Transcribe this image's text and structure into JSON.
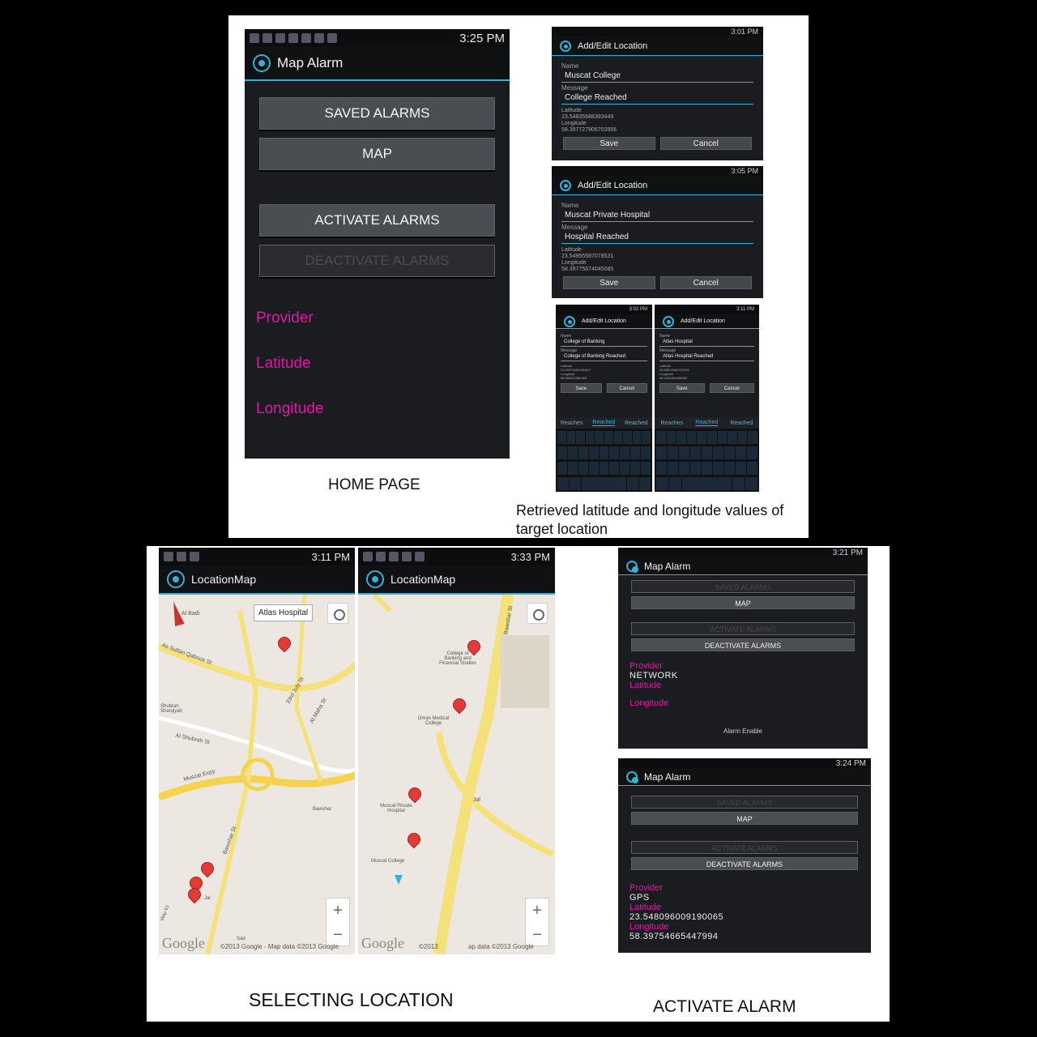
{
  "home": {
    "status_time": "3:25 PM",
    "app_title": "Map Alarm",
    "buttons": {
      "saved": "SAVED ALARMS",
      "map": "MAP",
      "activate": "ACTIVATE ALARMS",
      "deactivate": "DEACTIVATE ALARMS"
    },
    "labels": {
      "provider": "Provider",
      "latitude": "Latitude",
      "longitude": "Longitude"
    },
    "caption": "HOME PAGE"
  },
  "edit_screens": {
    "title": "Add/Edit Location",
    "name_label": "Name",
    "message_label": "Message",
    "latitude_label": "Latitude",
    "longitude_label": "Longitude",
    "save": "Save",
    "cancel": "Cancel",
    "items": [
      {
        "time": "3:01 PM",
        "name": "Muscat College",
        "message": "College Reached",
        "lat": "23.5483568839344​9",
        "lng": "58.39772790670395​6"
      },
      {
        "time": "3:05 PM",
        "name": "Muscat Private Hospital",
        "message": "Hospital Reached",
        "lat": "23.5495558707853​1",
        "lng": "58.39775674045085"
      },
      {
        "time": "3:02 PM",
        "name": "College of Banking",
        "message": "College of Banking Reached",
        "lat": "23.553732544016​04",
        "lng": "58.39881258030​9"
      },
      {
        "time": "3:11 PM",
        "name": "Atlas Hospital",
        "message": "Atlas Hospital Reached",
        "lat": "23.580234821​57392",
        "lng": "58.43319811586​52"
      }
    ],
    "suggestions": [
      "Reaches",
      "Reached",
      "Reached"
    ],
    "caption": "Retrieved latitude and longitude values of target location"
  },
  "maps": {
    "title": "LocationMap",
    "left_time": "3:11 PM",
    "right_time": "3:33 PM",
    "callout": "Atlas Hospital",
    "google": "Google",
    "copyright": "©2013 Google - Map data ©2013 Google",
    "right_copyright_a": "©2013",
    "right_copyright_b": "ap data ©2013 Google",
    "street_left": [
      "Al Badi",
      "As Sultan Qaboos St",
      "Shubrah Sharqiyah",
      "Al Shubrah St",
      "Muscat Expy",
      "Bawshar St",
      "Bawshar",
      "Way 61",
      "Jal",
      "Sad",
      "33rd July St",
      "Al Maha St"
    ],
    "places_right": [
      "College of Banking and Financial Studies",
      "Oman Medical College",
      "Muscat Private Hospital",
      "Muscat College",
      "Jal",
      "Bawshar St"
    ],
    "zoom_plus": "+",
    "zoom_minus": "−",
    "caption": "SELECTING LOCATION"
  },
  "activate": {
    "title": "Map Alarm",
    "top": {
      "time": "3:21 PM",
      "provider_label": "Provider",
      "provider": "NETWORK",
      "latitude_label": "Latitude",
      "longitude_label": "Longitude",
      "footer": "Alarm Enable"
    },
    "bottom": {
      "time": "3:24 PM",
      "provider_label": "Provider",
      "provider": "GPS",
      "latitude_label": "Latitude",
      "latitude": "23.548096009190065",
      "longitude_label": "Longitude",
      "longitude": "58.39754665447994"
    },
    "buttons": {
      "saved": "SAVED ALARMS",
      "map": "MAP",
      "activate": "ACTIVATE ALARMS",
      "deactivate": "DEACTIVATE ALARMS"
    },
    "caption": "ACTIVATE ALARM"
  },
  "colors": {
    "accent": "#2fb3d6",
    "label": "#e016a8",
    "pin": "#e23a36"
  }
}
